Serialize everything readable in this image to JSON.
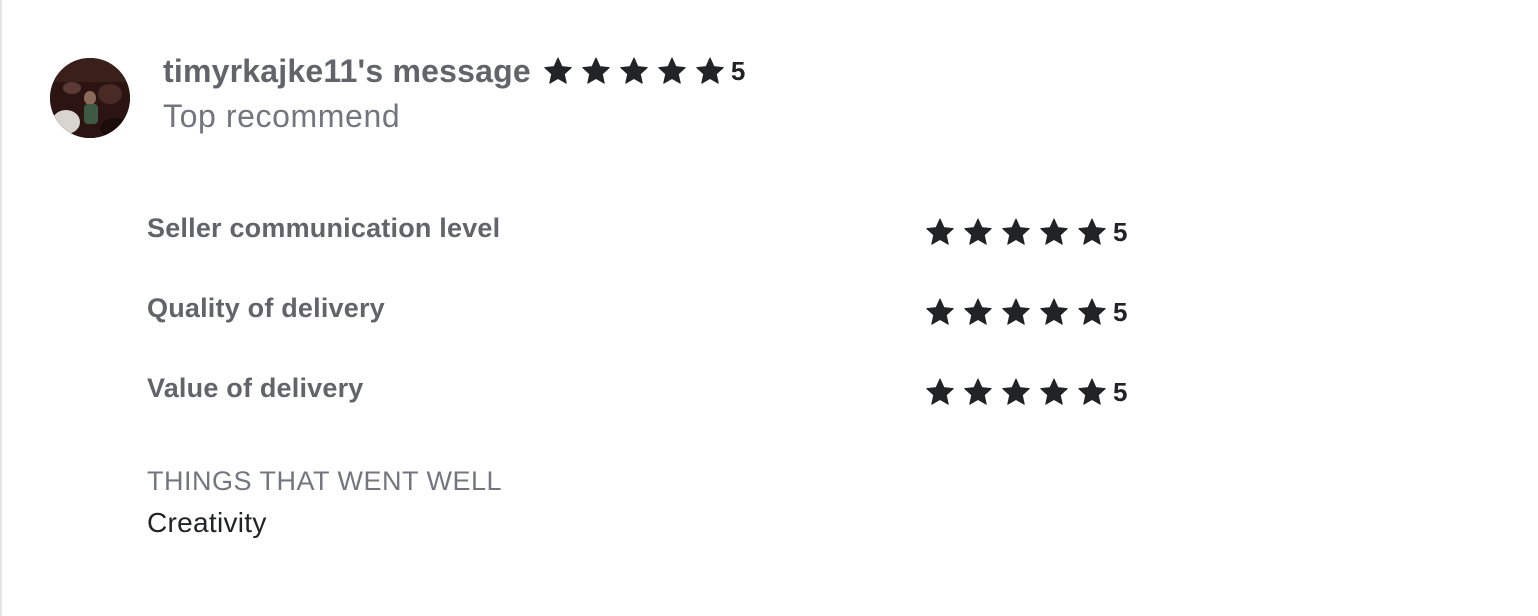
{
  "review": {
    "reviewer_name": "timyrkajke11's message",
    "overall_rating": 5,
    "overall_score_label": "5",
    "subtitle": "Top recommend"
  },
  "ratings": [
    {
      "label": "Seller communication level",
      "rating": 5,
      "score_label": "5"
    },
    {
      "label": "Quality of delivery",
      "rating": 5,
      "score_label": "5"
    },
    {
      "label": "Value of delivery",
      "rating": 5,
      "score_label": "5"
    }
  ],
  "things_went_well": {
    "heading": "THINGS THAT WENT WELL",
    "items": [
      "Creativity"
    ]
  },
  "icons": {
    "star": "star-icon",
    "avatar": "user-avatar"
  },
  "colors": {
    "star": "#222325",
    "muted_text": "#62646a",
    "secondary_text": "#74767e",
    "body_text": "#222325"
  }
}
